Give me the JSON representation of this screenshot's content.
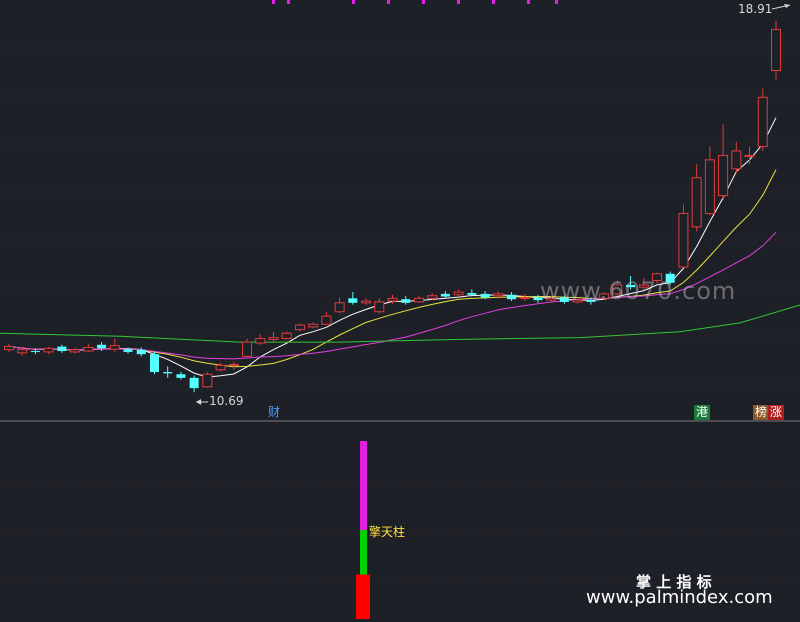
{
  "chart_data": [
    {
      "type": "candlestick",
      "price_high_label": "18.91",
      "price_low_label": "10.69",
      "ylim": [
        10.2,
        19.2
      ],
      "candles": [
        [
          11.55,
          11.62,
          11.5,
          11.68
        ],
        [
          11.48,
          11.55,
          11.42,
          11.62
        ],
        [
          11.52,
          11.5,
          11.45,
          11.58
        ],
        [
          11.5,
          11.58,
          11.45,
          11.62
        ],
        [
          11.62,
          11.52,
          11.48,
          11.66
        ],
        [
          11.5,
          11.55,
          11.46,
          11.6
        ],
        [
          11.52,
          11.6,
          11.5,
          11.68
        ],
        [
          11.66,
          11.58,
          11.52,
          11.72
        ],
        [
          11.56,
          11.64,
          11.5,
          11.8
        ],
        [
          11.56,
          11.5,
          11.46,
          11.6
        ],
        [
          11.55,
          11.45,
          11.4,
          11.6
        ],
        [
          11.45,
          11.05,
          11.0,
          11.5
        ],
        [
          11.05,
          11.02,
          10.92,
          11.18
        ],
        [
          11.0,
          10.92,
          10.88,
          11.05
        ],
        [
          10.92,
          10.69,
          10.6,
          10.97
        ],
        [
          10.72,
          11.0,
          10.7,
          11.05
        ],
        [
          11.1,
          11.2,
          11.06,
          11.26
        ],
        [
          11.2,
          11.22,
          11.1,
          11.28
        ],
        [
          11.4,
          11.72,
          11.38,
          11.8
        ],
        [
          11.7,
          11.8,
          11.66,
          11.9
        ],
        [
          11.78,
          11.82,
          11.7,
          11.95
        ],
        [
          11.8,
          11.92,
          11.78,
          11.96
        ],
        [
          12.0,
          12.1,
          11.96,
          12.14
        ],
        [
          12.06,
          12.12,
          12.02,
          12.16
        ],
        [
          12.12,
          12.3,
          12.1,
          12.4
        ],
        [
          12.4,
          12.6,
          12.36,
          12.72
        ],
        [
          12.7,
          12.6,
          12.56,
          12.84
        ],
        [
          12.6,
          12.64,
          12.55,
          12.7
        ],
        [
          12.4,
          12.62,
          12.36,
          12.7
        ],
        [
          12.64,
          12.7,
          12.58,
          12.78
        ],
        [
          12.68,
          12.6,
          12.56,
          12.75
        ],
        [
          12.62,
          12.7,
          12.6,
          12.76
        ],
        [
          12.7,
          12.76,
          12.66,
          12.82
        ],
        [
          12.8,
          12.74,
          12.7,
          12.86
        ],
        [
          12.78,
          12.84,
          12.74,
          12.9
        ],
        [
          12.82,
          12.78,
          12.74,
          12.9
        ],
        [
          12.8,
          12.72,
          12.68,
          12.86
        ],
        [
          12.76,
          12.8,
          12.7,
          12.86
        ],
        [
          12.78,
          12.68,
          12.64,
          12.84
        ],
        [
          12.7,
          12.72,
          12.64,
          12.8
        ],
        [
          12.72,
          12.66,
          12.6,
          12.78
        ],
        [
          12.66,
          12.7,
          12.6,
          12.76
        ],
        [
          12.72,
          12.62,
          12.58,
          12.76
        ],
        [
          12.62,
          12.66,
          12.58,
          12.72
        ],
        [
          12.66,
          12.62,
          12.56,
          12.72
        ],
        [
          12.7,
          12.8,
          12.66,
          12.84
        ],
        [
          12.8,
          13.0,
          12.76,
          13.1
        ],
        [
          13.0,
          12.95,
          12.9,
          13.2
        ],
        [
          12.95,
          13.0,
          12.88,
          13.15
        ],
        [
          13.1,
          13.25,
          13.04,
          13.28
        ],
        [
          13.25,
          13.05,
          13.0,
          13.3
        ],
        [
          13.4,
          14.6,
          13.38,
          14.8
        ],
        [
          14.3,
          15.4,
          14.2,
          15.7
        ],
        [
          14.6,
          15.8,
          14.56,
          16.1
        ],
        [
          15.0,
          15.9,
          14.9,
          16.6
        ],
        [
          15.6,
          16.0,
          15.5,
          16.2
        ],
        [
          15.9,
          15.9,
          15.7,
          16.1
        ],
        [
          16.1,
          17.2,
          16.0,
          17.4
        ],
        [
          17.8,
          18.72,
          17.6,
          18.91
        ]
      ],
      "ma_colors": [
        "#ffffff",
        "#e8e23a",
        "#e040e0",
        "#32c832"
      ]
    },
    {
      "type": "bar",
      "indicator_name": "擎天柱",
      "segments": [
        {
          "color": "#ff0000",
          "value": 40
        },
        {
          "color": "#00d000",
          "value": 40
        },
        {
          "color": "#e020e0",
          "value": 80
        }
      ]
    }
  ],
  "annotations": {
    "cai": "财",
    "gang": "港",
    "bang": "榜",
    "zhang": "涨"
  },
  "watermark": {
    "faint_url": "www.6070.com",
    "brand": "掌 上 指 标",
    "url": "www.palmindex.com"
  },
  "colors": {
    "up": "#e03a3a",
    "down": "#54ffff",
    "grid": "#5a2020",
    "bg": "#1e2028"
  }
}
